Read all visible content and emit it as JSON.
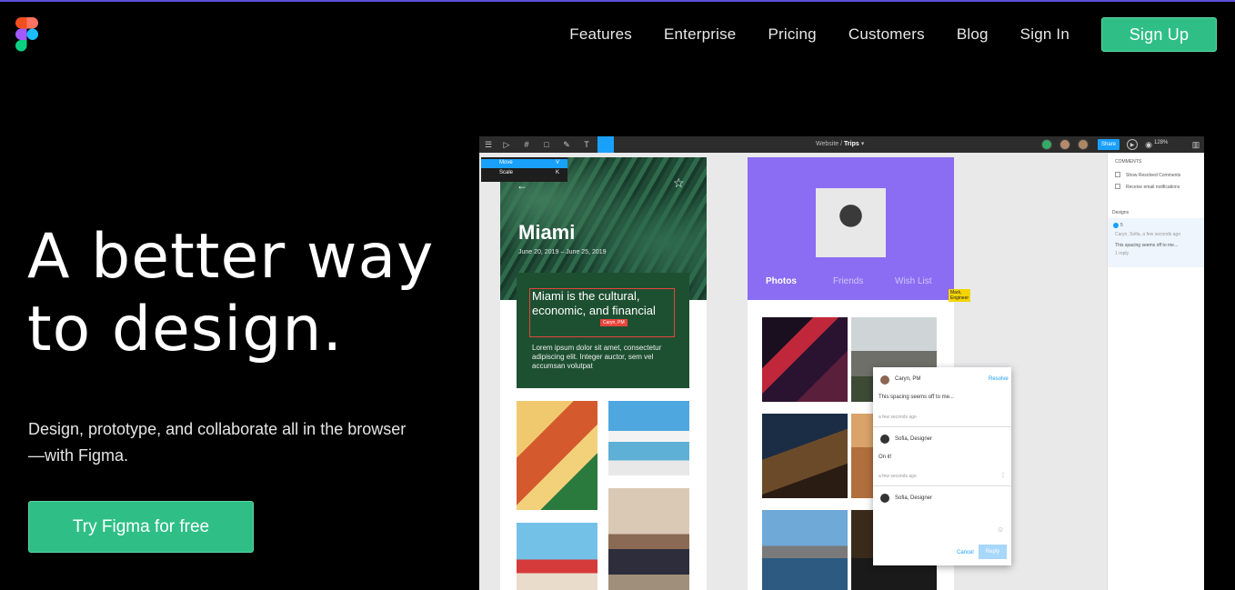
{
  "nav": {
    "links": [
      "Features",
      "Enterprise",
      "Pricing",
      "Customers",
      "Blog",
      "Sign In"
    ],
    "signup": "Sign Up"
  },
  "hero": {
    "title_line1": "A better way",
    "title_line2": "to design.",
    "subtitle": "Design, prototype, and collaborate all in the browser—with Figma.",
    "cta": "Try Figma for free"
  },
  "editor": {
    "breadcrumb_parent": "Website",
    "breadcrumb_current": "Trips",
    "share": "Share",
    "zoom": "128%",
    "menu": [
      {
        "label": "Move",
        "key": "V"
      },
      {
        "label": "Scale",
        "key": "K"
      }
    ],
    "frame1": {
      "city": "Miami",
      "dates": "June 20, 2019 – June 25, 2019",
      "headline": "Miami is the cultural, economic, and financial",
      "body": "Lorem ipsum dolor sit amet, consectetur adipiscing elit. Integer auctor, sem vel accumsan volutpat",
      "cursor_tag": "Caryn, PM"
    },
    "frame2": {
      "tabs": [
        "Photos",
        "Friends",
        "Wish List"
      ],
      "cursor_tag": "Mark, Engineer"
    },
    "comments": {
      "c1_author": "Caryn, PM",
      "c1_resolve": "Resolve",
      "c1_text": "This spacing seems off to me...",
      "c1_time": "a few seconds ago",
      "c2_author": "Sofia, Designer",
      "c2_text": "On it!",
      "c2_time": "a few seconds ago",
      "c3_author": "Sofia, Designer",
      "cancel": "Cancel",
      "reply": "Reply"
    },
    "panel": {
      "heading": "COMMENTS",
      "opt1": "Show Resolved Comments",
      "opt2": "Receive email notifications",
      "section": "Designs",
      "thread_num": "5",
      "thread_people": "Caryn, Sofia, a few seconds ago",
      "thread_text": "This spacing seems off to me...",
      "thread_replies": "1 reply"
    }
  },
  "colors": {
    "brand_green": "#2fbf86",
    "figma_blue": "#18a0fb",
    "accent_purple": "#8a6df2"
  }
}
